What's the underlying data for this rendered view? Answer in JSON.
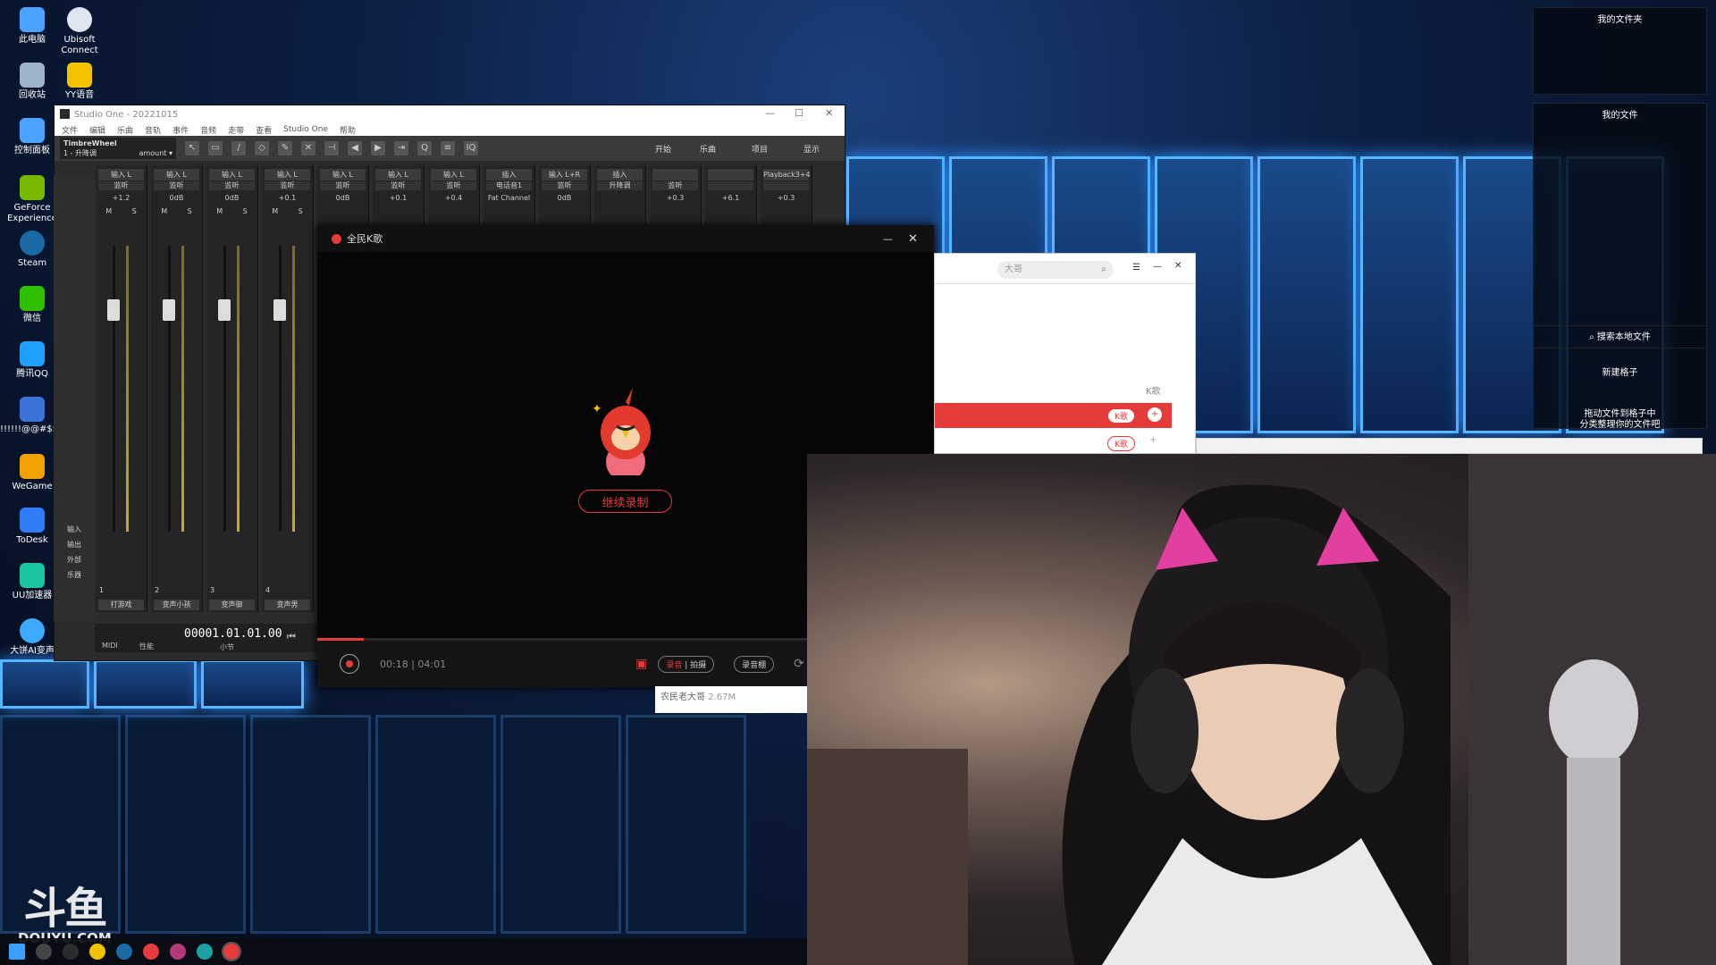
{
  "desktop": {
    "icons": [
      {
        "label": "此电脑",
        "color": "#4aa3ff"
      },
      {
        "label": "Ubisoft Connect",
        "color": "#dfe6f2"
      },
      {
        "label": "回收站",
        "color": "#9fb3c8"
      },
      {
        "label": "YY语音",
        "color": "#f3c300"
      },
      {
        "label": "控制面板",
        "color": "#4aa3ff"
      },
      {
        "label": "GeForce Experience",
        "color": "#76b900"
      },
      {
        "label": "Steam",
        "color": "#1b6aa5"
      },
      {
        "label": "微信",
        "color": "#2dc100"
      },
      {
        "label": "腾讯QQ",
        "color": "#1fa0ff"
      },
      {
        "label": "!!!!!!@@#$$%",
        "color": "#3a72d8"
      },
      {
        "label": "WeGame",
        "color": "#f2a100"
      },
      {
        "label": "ToDesk",
        "color": "#2f7cf6"
      },
      {
        "label": "UU加速器",
        "color": "#19c5a0"
      },
      {
        "label": "大饼AI变声",
        "color": "#3da9ff"
      }
    ]
  },
  "file_panel": {
    "top_title": "我的文件夹",
    "second_title": "我的文件",
    "search_label": "搜索本地文件",
    "new_grid": "新建格子",
    "hint_line1": "拖动文件到格子中",
    "hint_line2": "分类整理你的文件吧"
  },
  "studio_one": {
    "title": "Studio One - 20221015",
    "menu": [
      "文件",
      "编辑",
      "乐曲",
      "音轨",
      "事件",
      "音频",
      "走带",
      "查看",
      "Studio One",
      "帮助"
    ],
    "track_name": "TimbreWheel",
    "track_sub": "1 - 升降调",
    "track_param": "amount ▾",
    "toolbar_right": [
      "开始",
      "乐曲",
      "项目",
      "显示"
    ],
    "channels": [
      {
        "in": "输入 L",
        "mon": "监听",
        "val": "+1.2",
        "num": "1",
        "name": "打游戏"
      },
      {
        "in": "输入 L",
        "mon": "监听",
        "val": "0dB",
        "num": "2",
        "name": "变声小孩"
      },
      {
        "in": "输入 L",
        "mon": "监听",
        "val": "0dB",
        "num": "3",
        "name": "变声御"
      },
      {
        "in": "输入 L",
        "mon": "监听",
        "val": "+0.1",
        "num": "4",
        "name": "变声男"
      },
      {
        "in": "输入 L",
        "mon": "监听",
        "val": "0dB",
        "num": "",
        "name": ""
      },
      {
        "in": "输入 L",
        "mon": "监听",
        "val": "+0.1",
        "num": "",
        "name": ""
      },
      {
        "in": "输入 L",
        "mon": "监听",
        "val": "+0.4",
        "num": "",
        "name": ""
      },
      {
        "in": "插入",
        "mon": "电话音1",
        "val": "Fat Channel",
        "num": "",
        "name": ""
      },
      {
        "in": "输入 L+R",
        "mon": "监听",
        "val": "0dB",
        "num": "",
        "name": ""
      },
      {
        "in": "插入",
        "mon": "升降调",
        "val": "",
        "num": "",
        "name": ""
      },
      {
        "in": "",
        "mon": "监听",
        "val": "+0.3",
        "num": "",
        "name": ""
      },
      {
        "in": "",
        "mon": "",
        "val": "+6.1",
        "num": "",
        "name": ""
      },
      {
        "in": "Playback3+4",
        "mon": "",
        "val": "+0.3",
        "num": "",
        "name": ""
      }
    ],
    "side_labels": [
      "输入",
      "输出",
      "外部",
      "乐器"
    ],
    "timecode": "00001.01.01.00",
    "timecode_sub": "小节",
    "bottom_left": "MIDI",
    "bottom_mid": "性能"
  },
  "karaoke": {
    "title": "全民K歌",
    "continue_label": "继续录制",
    "time": "00:18 | 04:01",
    "record_label": "录音",
    "video_label": "拍摄",
    "studio_label": "录音棚",
    "progress": 0.075
  },
  "music_list": {
    "search_placeholder": "大哥",
    "column_label": "K歌",
    "k_btn": "K歌",
    "song_info_name": "农民老大哥",
    "song_info_size": "2.67M"
  },
  "watermark": {
    "brand": "斗鱼",
    "url": "DOUYU.COM"
  },
  "colors": {
    "accent_red": "#e63b3b",
    "desktop_blue": "#3aa0ff"
  }
}
